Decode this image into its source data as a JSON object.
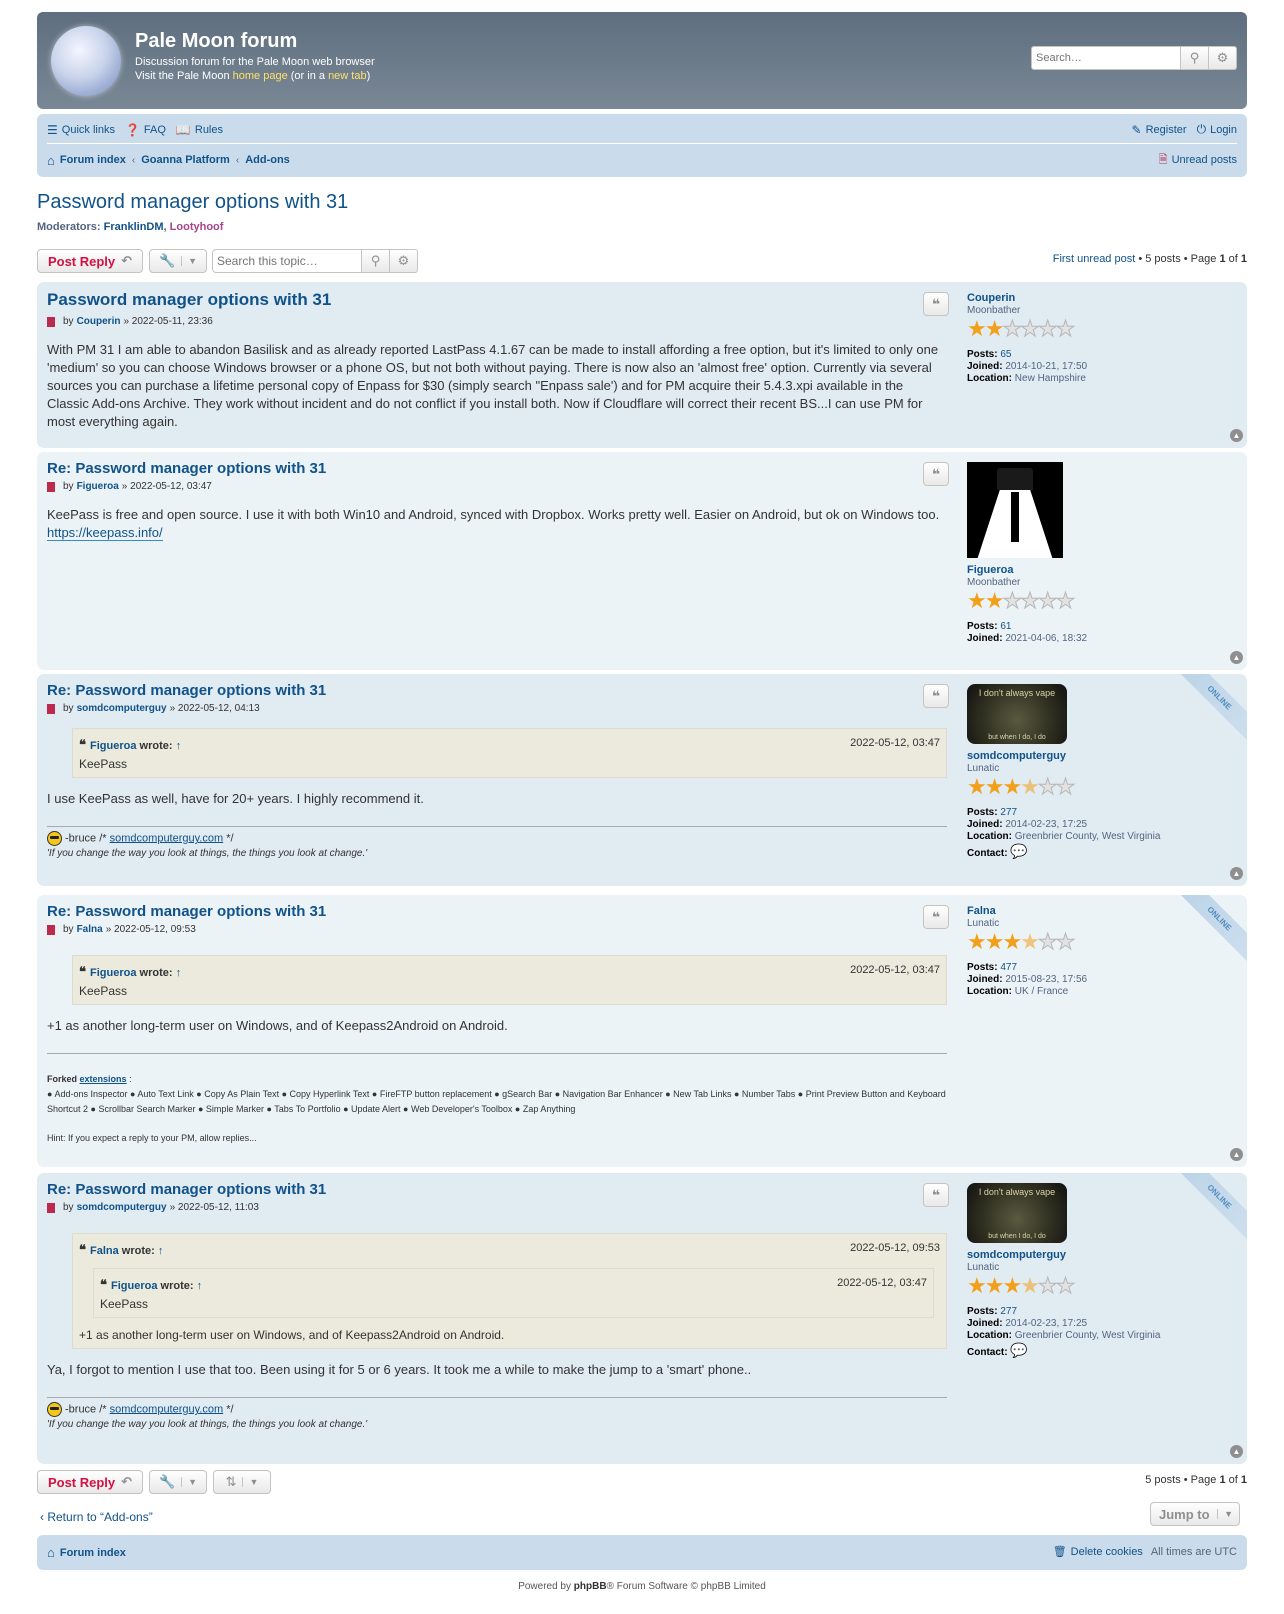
{
  "header": {
    "site_title": "Pale Moon forum",
    "site_description": "Discussion forum for the Pale Moon web browser",
    "visit_prefix": "Visit the Pale Moon",
    "home_page_link": "home page",
    "or_in_a": "(or in a",
    "new_tab_link": "new tab",
    "close_paren": ")",
    "search_placeholder": "Search…"
  },
  "navbar": {
    "quick_links": "Quick links",
    "faq": "FAQ",
    "rules": "Rules",
    "register": "Register",
    "login": "Login",
    "breadcrumbs": [
      "Forum index",
      "Goanna Platform",
      "Add-ons"
    ],
    "unread_posts": "Unread posts"
  },
  "topic": {
    "title": "Password manager options with 31",
    "moderators_label": "Moderators",
    "moderator_1": "FranklinDM",
    "moderator_2": "Lootyhoof"
  },
  "actionbar_top": {
    "post_reply": "Post Reply",
    "search_placeholder": "Search this topic…",
    "first_unread": "First unread post",
    "summary": "• 5 posts • Page",
    "page_current": "1",
    "of": "of",
    "page_total": "1"
  },
  "posts": [
    {
      "title": "Password manager options with 31",
      "by": "by",
      "author": "Couperin",
      "datetime": "» 2022-05-11, 23:36",
      "content": "With PM 31 I am able to abandon Basilisk and as already reported LastPass 4.1.67 can be made to install affording a free option, but it's limited to only one 'medium' so you can choose Windows browser or a phone OS, but not both without paying. There is now also an 'almost free' option. Currently via several sources you can purchase a lifetime personal copy of Enpass for $30 (simply search \"Enpass sale') and for PM acquire their 5.4.3.xpi available in the Classic Add-ons Archive. They work without incident and do not conflict if you install both. Now if Cloudflare will correct their recent BS...I can use PM for most everything again.",
      "profile": {
        "username": "Couperin",
        "rank": "Moonbather",
        "stars": 2,
        "posts_label": "Posts:",
        "posts": "65",
        "joined_label": "Joined:",
        "joined": "2014-10-21, 17:50",
        "location_label": "Location:",
        "location": "New Hampshire"
      }
    },
    {
      "title": "Re: Password manager options with 31",
      "by": "by",
      "author": "Figueroa",
      "datetime": "» 2022-05-12, 03:47",
      "content": "KeePass is free and open source. I use it with both Win10 and Android, synced with Dropbox. Works pretty well. Easier on Android, but ok on Windows too.",
      "link": "https://keepass.info/",
      "profile": {
        "username": "Figueroa",
        "rank": "Moonbather",
        "stars": 2,
        "posts_label": "Posts:",
        "posts": "61",
        "joined_label": "Joined:",
        "joined": "2021-04-06, 18:32"
      }
    },
    {
      "title": "Re: Password manager options with 31",
      "by": "by",
      "author": "somdcomputerguy",
      "datetime": "» 2022-05-12, 04:13",
      "quote": {
        "author": "Figueroa",
        "wrote": "wrote:",
        "arrow": "↑",
        "date": "2022-05-12, 03:47",
        "text": "KeePass"
      },
      "content": "I use KeePass as well, have for 20+ years. I highly recommend it.",
      "signature": {
        "prefix": "-bruce /*",
        "link": "somdcomputerguy.com",
        "suffix": "*/",
        "quote": "'If you change the way you look at things, the things you look at change.'"
      },
      "online": "ONLINE",
      "avatar_top": "I don't always vape",
      "avatar_bottom": "but when I do, I do",
      "profile": {
        "username": "somdcomputerguy",
        "rank": "Lunatic",
        "stars": 3.5,
        "posts_label": "Posts:",
        "posts": "277",
        "joined_label": "Joined:",
        "joined": "2014-02-23, 17:25",
        "location_label": "Location:",
        "location": "Greenbrier County, West Virginia",
        "contact_label": "Contact:"
      }
    },
    {
      "title": "Re: Password manager options with 31",
      "by": "by",
      "author": "Falna",
      "datetime": "» 2022-05-12, 09:53",
      "quote": {
        "author": "Figueroa",
        "wrote": "wrote:",
        "arrow": "↑",
        "date": "2022-05-12, 03:47",
        "text": "KeePass"
      },
      "content": "+1 as another long-term user on Windows, and of Keepass2Android on Android.",
      "sig_forked": "Forked",
      "sig_extensions": "extensions",
      "sig_colon": ":",
      "sig_list": "● Add-ons Inspector ● Auto Text Link ● Copy As Plain Text ● Copy Hyperlink Text ● FireFTP button replacement ● gSearch Bar ● Navigation Bar Enhancer ● New Tab Links ● Number Tabs ● Print Preview Button and Keyboard Shortcut 2 ● Scrollbar Search Marker ● Simple Marker ● Tabs To Portfolio ● Update Alert ● Web Developer's Toolbox ● Zap Anything",
      "sig_hint": "Hint: If you expect a reply to your PM, allow replies...",
      "online": "ONLINE",
      "profile": {
        "username": "Falna",
        "rank": "Lunatic",
        "stars": 3.5,
        "posts_label": "Posts:",
        "posts": "477",
        "joined_label": "Joined:",
        "joined": "2015-08-23, 17:56",
        "location_label": "Location:",
        "location": "UK / France"
      }
    },
    {
      "title": "Re: Password manager options with 31",
      "by": "by",
      "author": "somdcomputerguy",
      "datetime": "» 2022-05-12, 11:03",
      "quote": {
        "author": "Falna",
        "wrote": "wrote:",
        "arrow": "↑",
        "date": "2022-05-12, 09:53",
        "inner_author": "Figueroa",
        "inner_date": "2022-05-12, 03:47",
        "inner_text": "KeePass",
        "text": "+1 as another long-term user on Windows, and of Keepass2Android on Android."
      },
      "content": "Ya, I forgot to mention I use that too. Been using it for 5 or 6 years. It took me a while to make the jump to a 'smart' phone..",
      "signature": {
        "prefix": "-bruce /*",
        "link": "somdcomputerguy.com",
        "suffix": "*/",
        "quote": "'If you change the way you look at things, the things you look at change.'"
      },
      "online": "ONLINE",
      "avatar_top": "I don't always vape",
      "avatar_bottom": "but when I do, I do",
      "profile": {
        "username": "somdcomputerguy",
        "rank": "Lunatic",
        "stars": 3.5,
        "posts_label": "Posts:",
        "posts": "277",
        "joined_label": "Joined:",
        "joined": "2014-02-23, 17:25",
        "location_label": "Location:",
        "location": "Greenbrier County, West Virginia",
        "contact_label": "Contact:"
      }
    }
  ],
  "actionbar_bottom": {
    "post_reply": "Post Reply",
    "summary": "5 posts • Page",
    "page_current": "1",
    "of": "of",
    "page_total": "1"
  },
  "footer": {
    "return_link": "Return to “Add-ons”",
    "jump_to": "Jump to",
    "forum_index": "Forum index",
    "delete_cookies": "Delete cookies",
    "timezone": "All times are UTC",
    "powered_prefix": "Powered by",
    "phpbb": "phpBB",
    "powered_suffix": "® Forum Software © phpBB Limited"
  },
  "icons": {
    "search": "search-icon",
    "gear": "gear-icon",
    "wrench": "wrench-icon",
    "reply": "reply-icon",
    "quote": "quote-icon",
    "home": "home-icon",
    "top": "arrow-up-icon"
  },
  "colors": {
    "header_bg": "#6b7987",
    "nav_bg": "#cadceb",
    "post_bg_dark": "#e1ebf2",
    "post_bg_light": "#ecf3f7",
    "link": "#105289",
    "reply_red": "#d31141",
    "star": "#f29f1a"
  }
}
